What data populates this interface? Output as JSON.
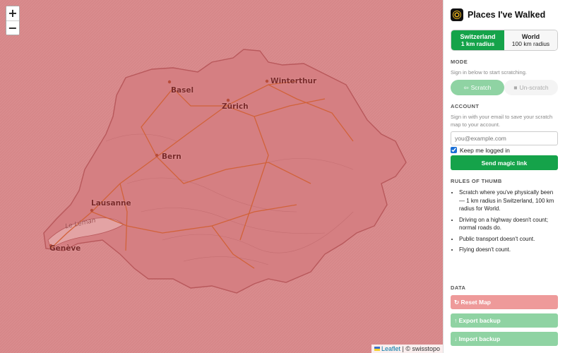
{
  "map": {
    "zoom_in": "+",
    "zoom_out": "−",
    "cities": [
      "Basel",
      "Winterthur",
      "Zürich",
      "Bern",
      "Lausanne",
      "Genève"
    ],
    "lake_label": "Le Léman",
    "attribution_link": "Leaflet",
    "attribution_rest": "| © swisstopo",
    "overlay_color": "#d9898b",
    "road_color": "#d1623a"
  },
  "sidebar": {
    "title": "Places I've Walked",
    "regions": [
      {
        "name": "Switzerland",
        "radius": "1 km radius"
      },
      {
        "name": "World",
        "radius": "100 km radius"
      }
    ],
    "mode": {
      "heading": "MODE",
      "hint": "Sign in below to start scratching.",
      "scratch_label": "Scratch",
      "unscratch_label": "Un-scratch"
    },
    "account": {
      "heading": "ACCOUNT",
      "hint": "Sign in with your email to save your scratch map to your account.",
      "email_placeholder": "you@example.com",
      "keep_logged_in": "Keep me logged in",
      "send_button": "Send magic link"
    },
    "rules": {
      "heading": "RULES OF THUMB",
      "items": [
        "Scratch where you've physically been — 1 km radius in Switzerland, 100 km radius for World.",
        "Driving on a highway doesn't count; normal roads do.",
        "Public transport doesn't count.",
        "Flying doesn't count."
      ]
    },
    "data": {
      "heading": "DATA",
      "reset": "Reset Map",
      "export": "Export backup",
      "import": "Import backup"
    },
    "accent": "#15a34a"
  }
}
